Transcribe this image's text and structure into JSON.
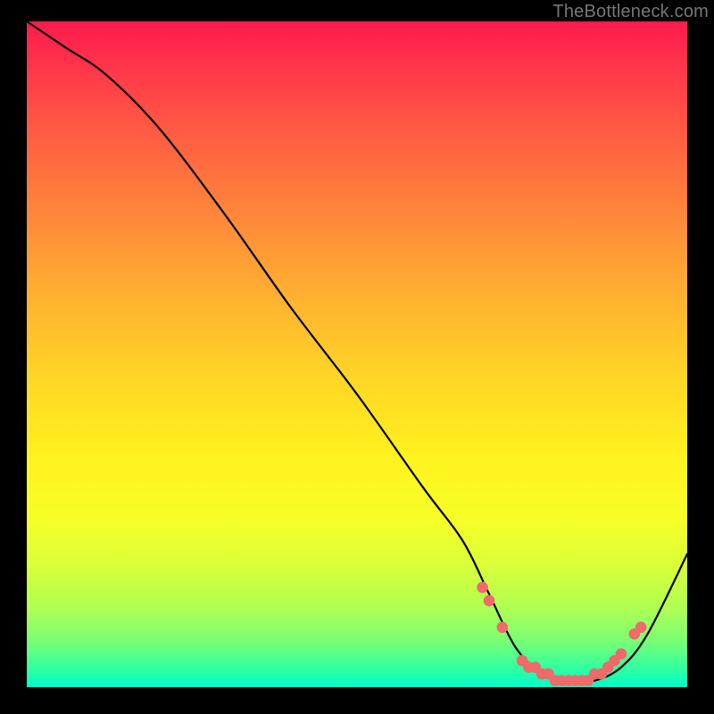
{
  "watermark": "TheBottleneck.com",
  "colors": {
    "dot": "#ef6a6a",
    "curve": "#000000"
  },
  "chart_data": {
    "type": "line",
    "title": "",
    "xlabel": "",
    "ylabel": "",
    "xlim": [
      0,
      100
    ],
    "ylim": [
      0,
      100
    ],
    "grid": false,
    "legend": false,
    "series": [
      {
        "name": "bottleneck-curve",
        "x": [
          0,
          6,
          12,
          20,
          30,
          40,
          50,
          60,
          66,
          70,
          74,
          78,
          82,
          86,
          90,
          94,
          100
        ],
        "y": [
          100,
          96,
          92,
          84,
          71,
          57,
          44,
          30,
          22,
          14,
          6,
          2,
          1,
          1,
          3,
          8,
          20
        ]
      }
    ],
    "markers": {
      "name": "highlight-dots",
      "x": [
        69,
        70,
        72,
        75,
        76,
        77,
        78,
        79,
        80,
        81,
        82,
        83,
        84,
        85,
        86,
        87,
        88,
        89,
        90,
        92,
        93
      ],
      "y": [
        15,
        13,
        9,
        4,
        3,
        3,
        2,
        2,
        1,
        1,
        1,
        1,
        1,
        1,
        2,
        2,
        3,
        4,
        5,
        8,
        9
      ]
    }
  }
}
